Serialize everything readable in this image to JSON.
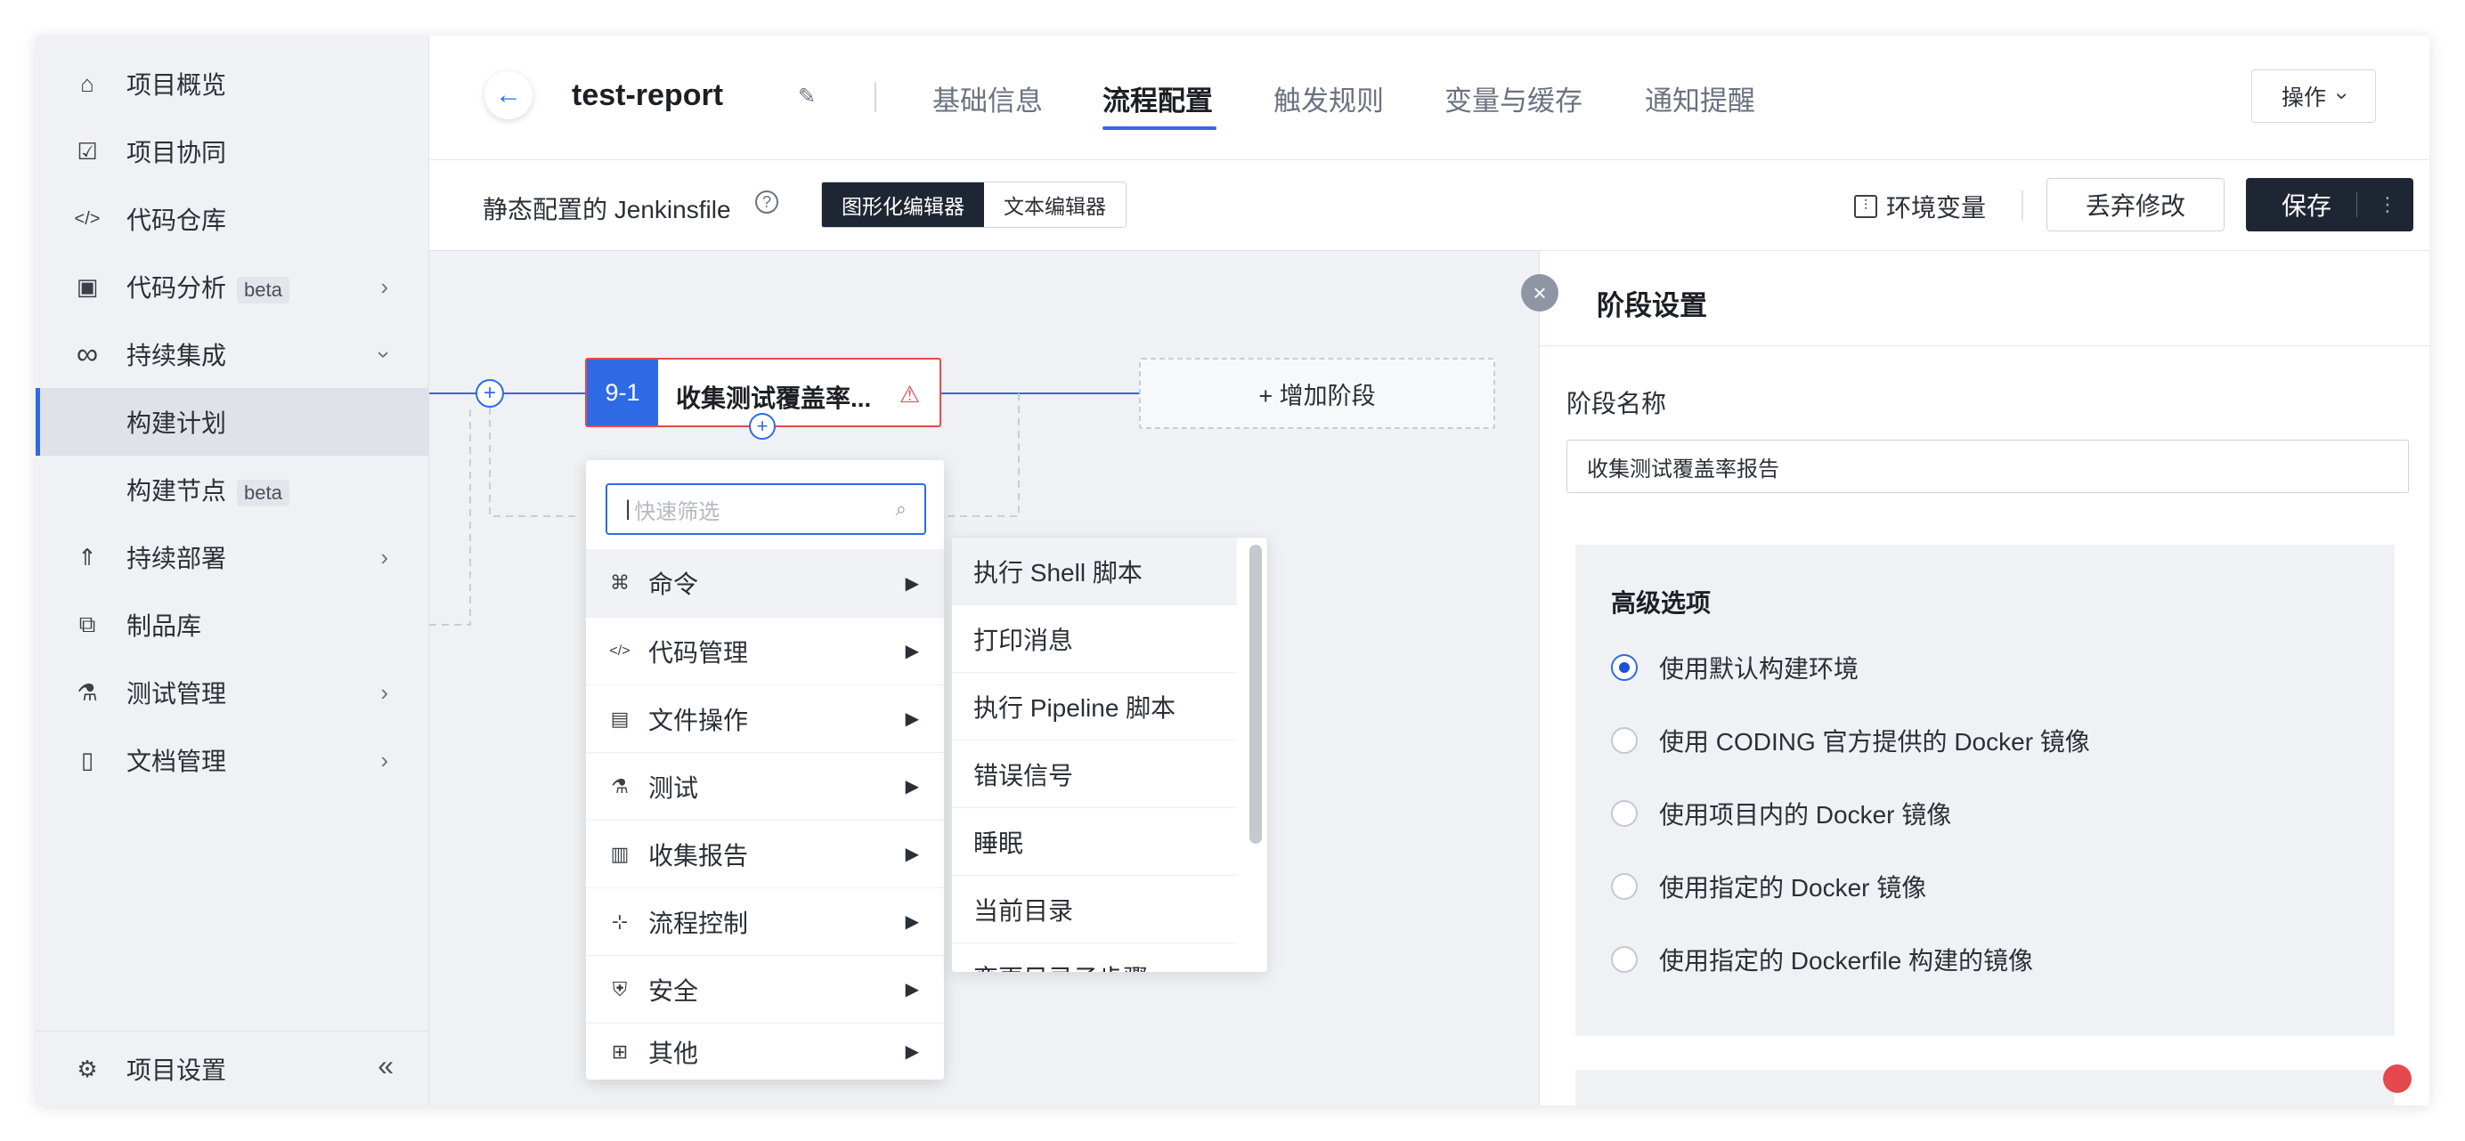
{
  "sidebar": {
    "items": [
      {
        "label": "项目概览",
        "icon": "home-icon",
        "glyph": "⌂"
      },
      {
        "label": "项目协同",
        "icon": "checkbox-icon",
        "glyph": "☑"
      },
      {
        "label": "代码仓库",
        "icon": "code-icon",
        "glyph": "</>"
      },
      {
        "label": "代码分析",
        "badge": "beta",
        "icon": "terminal-icon",
        "glyph": "▣"
      },
      {
        "label": "持续集成",
        "icon": "infinity-icon",
        "glyph": "∞"
      },
      {
        "label": "构建计划"
      },
      {
        "label": "构建节点",
        "badge": "beta"
      },
      {
        "label": "持续部署",
        "icon": "rocket-icon",
        "glyph": "⇑"
      },
      {
        "label": "制品库",
        "icon": "package-icon",
        "glyph": "⧉"
      },
      {
        "label": "测试管理",
        "icon": "flask-icon",
        "glyph": "⚗"
      },
      {
        "label": "文档管理",
        "icon": "document-icon",
        "glyph": "▯"
      }
    ],
    "settings_label": "项目设置"
  },
  "header": {
    "title": "test-report",
    "tabs": [
      "基础信息",
      "流程配置",
      "触发规则",
      "变量与缓存",
      "通知提醒"
    ],
    "active_tab": "流程配置",
    "op_label": "操作"
  },
  "toolbar": {
    "label": "静态配置的 Jenkinsfile",
    "editor_graphic": "图形化编辑器",
    "editor_text": "文本编辑器",
    "env_label": "环境变量",
    "discard_label": "丢弃修改",
    "save_label": "保存"
  },
  "canvas": {
    "stage_num": "9-1",
    "stage_name": "收集测试覆盖率...",
    "add_stage": "+ 增加阶段"
  },
  "menu": {
    "search_placeholder": "快速筛选",
    "items": [
      {
        "label": "命令",
        "icon": "command-icon",
        "glyph": "⌘"
      },
      {
        "label": "代码管理",
        "icon": "code-icon",
        "glyph": "</>"
      },
      {
        "label": "文件操作",
        "icon": "file-icon",
        "glyph": "▤"
      },
      {
        "label": "测试",
        "icon": "flask-icon",
        "glyph": "⚗"
      },
      {
        "label": "收集报告",
        "icon": "report-icon",
        "glyph": "▥"
      },
      {
        "label": "流程控制",
        "icon": "flow-icon",
        "glyph": "⊹"
      },
      {
        "label": "安全",
        "icon": "shield-icon",
        "glyph": "⛨"
      },
      {
        "label": "其他",
        "icon": "grid-icon",
        "glyph": "⊞"
      }
    ],
    "sub_items": [
      "执行 Shell 脚本",
      "打印消息",
      "执行 Pipeline 脚本",
      "错误信号",
      "睡眠",
      "当前目录",
      "变更目录子步骤"
    ]
  },
  "panel": {
    "title": "阶段设置",
    "name_label": "阶段名称",
    "name_value": "收集测试覆盖率报告",
    "advanced_title": "高级选项",
    "options": [
      "使用默认构建环境",
      "使用 CODING 官方提供的 Docker 镜像",
      "使用项目内的 Docker 镜像",
      "使用指定的 Docker 镜像",
      "使用指定的 Dockerfile 构建的镜像"
    ],
    "selected_option": 0
  },
  "colors": {
    "accent": "#2f6ae6",
    "dark": "#1f2633",
    "error": "#e5484d"
  }
}
